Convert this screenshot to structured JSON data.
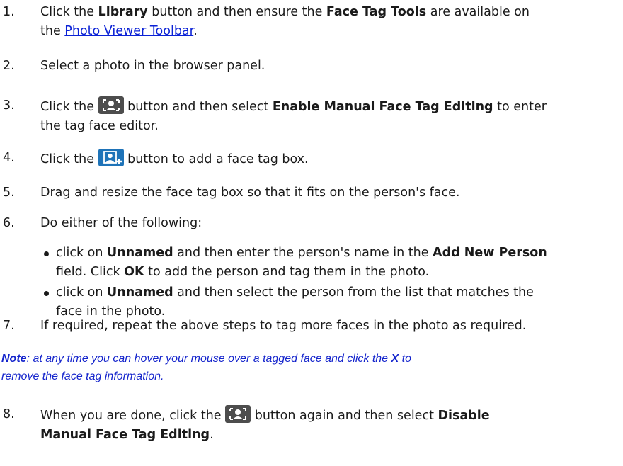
{
  "steps": [
    {
      "num": "1.",
      "pre": "Click the ",
      "b1": "Library",
      "mid": " button and then ensure the ",
      "b2": "Face Tag Tools",
      "post": " are available on",
      "line2_pre": "the ",
      "link": "Photo Viewer Toolbar",
      "line2_post": "."
    },
    {
      "num": "2.",
      "text": "Select a photo in the browser panel."
    },
    {
      "num": "3.",
      "pre": "Click the ",
      "mid": " button and then select ",
      "b1": "Enable Manual Face Tag Editing",
      "post": " to enter",
      "line2": "the tag face editor."
    },
    {
      "num": "4.",
      "pre": "Click the ",
      "post": " button to add a face tag box."
    },
    {
      "num": "5.",
      "text": "Drag and resize the face tag box so that it fits on the person's face."
    },
    {
      "num": "6.",
      "text": "Do either of the following:"
    },
    {
      "num": "7.",
      "text": "If required, repeat the above steps to tag more faces in the photo as required."
    },
    {
      "num": "8.",
      "pre": "When you are done, click the ",
      "mid": " button again and then select ",
      "b1": "Disable",
      "line2_b": "Manual Face Tag Editing",
      "line2_post": "."
    }
  ],
  "bullets": [
    {
      "pre": "click on ",
      "b1": "Unnamed",
      "mid": " and then enter the person's name in the ",
      "b2": "Add New Person",
      "line2_pre": "field. Click ",
      "b3": "OK",
      "line2_post": " to add the person and tag them in the photo."
    },
    {
      "pre": "click on ",
      "b1": "Unnamed",
      "post": " and then select the person from the list that matches the",
      "line2": "face in the photo."
    }
  ],
  "note": {
    "b1": "Note",
    "t1": ": at any time you can hover your mouse over a tagged face and click the ",
    "b2": "X",
    "t2": " to",
    "line2": "remove the face tag information."
  },
  "icons": {
    "face_tag": "face-tag-icon",
    "add_face": "add-face-tag-icon"
  }
}
